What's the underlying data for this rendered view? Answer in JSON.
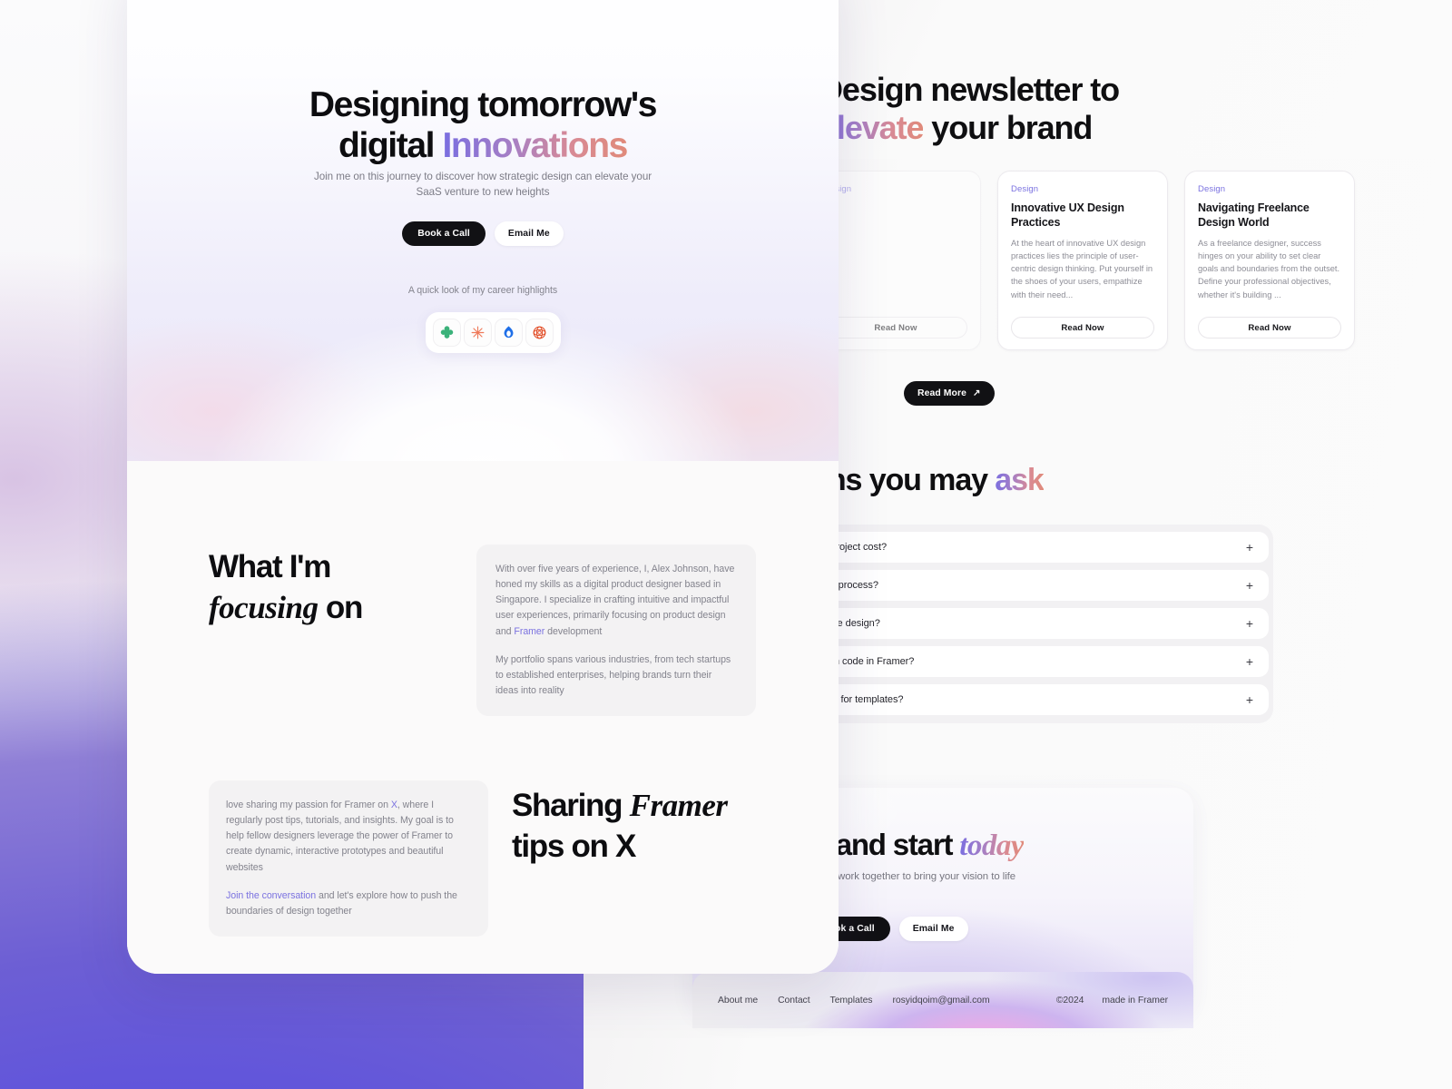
{
  "left_panel": {
    "hero": {
      "title_line1": "Designing tomorrow's",
      "title_line2_plain": "digital ",
      "title_line2_accent": "Innovations",
      "subtitle": "Join me on this journey to discover how strategic design can elevate your SaaS venture to new heights",
      "primary_button": "Book a Call",
      "secondary_button": "Email Me",
      "highlights_label": "A quick look of my career highlights",
      "logos": [
        {
          "name": "clover-logo-icon",
          "color": "#3bb27a"
        },
        {
          "name": "asterisk-logo-icon",
          "color": "#ef7a5a"
        },
        {
          "name": "droplet-logo-icon",
          "color": "#1f6fe8"
        },
        {
          "name": "flower-logo-icon",
          "color": "#e2502a"
        }
      ]
    },
    "focus_section": {
      "title_part1": "What I'm",
      "title_italic": "focusing",
      "title_part2": " on",
      "paragraph1_a": "With over five years of experience, I, Alex Johnson, have honed my skills as a digital product designer based in Singapore. I specialize in crafting intuitive and impactful user experiences, primarily focusing on product design and ",
      "paragraph1_link": "Framer",
      "paragraph1_b": " development",
      "paragraph2": "My portfolio spans various industries, from tech startups to established enterprises, helping brands turn their ideas into reality"
    },
    "sharing_section": {
      "title_part1": "Sharing ",
      "title_italic": "Framer",
      "title_part2": "tips on X",
      "paragraph1_a": "love sharing my passion for Framer on ",
      "paragraph1_link": "X",
      "paragraph1_b": ", where I regularly post tips, tutorials, and insights. My goal is to help fellow designers leverage the power of Framer to create dynamic, interactive prototypes and beautiful websites",
      "paragraph2_link": "Join the conversation",
      "paragraph2_rest": " and let's explore how to push the boundaries of design together"
    }
  },
  "right_panel": {
    "newsletter": {
      "title_line1": "Design newsletter to",
      "title_accent": "elevate",
      "title_line2_rest": " your brand"
    },
    "blog": {
      "ghost_card": {
        "category": "Design",
        "title": "",
        "excerpt": "",
        "button": "Read Now"
      },
      "cards": [
        {
          "category": "Design",
          "title": "Innovative UX Design Practices",
          "excerpt": "At the heart of innovative UX design practices lies the principle of user-centric design thinking. Put yourself in the shoes of your users, empathize with their need...",
          "button": "Read Now"
        },
        {
          "category": "Design",
          "title": "Navigating Freelance Design World",
          "excerpt": "As a freelance designer, success hinges on your ability to set clear goals and boundaries from the outset. Define your professional objectives, whether it's building ...",
          "button": "Read Now"
        }
      ],
      "read_more_label": "Read More",
      "read_more_icon": "arrow-up-right-icon"
    },
    "faq": {
      "title_plain": "Questions you may ",
      "title_accent": "ask",
      "items": [
        {
          "question": "How much does a project cost?",
          "toggle": "+"
        },
        {
          "question": "What is your design process?",
          "toggle": "+"
        },
        {
          "question": "What if I don't like the design?",
          "toggle": "+"
        },
        {
          "question": "Can you add custom code in Framer?",
          "toggle": "+"
        },
        {
          "question": "Do you offer refunds for templates?",
          "toggle": "+"
        }
      ]
    },
    "cta": {
      "title_plain": "Let's talk and start ",
      "title_accent": "today",
      "subtitle": "Got a project in mind? Let's work together to bring your vision to life",
      "primary_button": "Book a Call",
      "secondary_button": "Email Me"
    },
    "footer": {
      "links": [
        "About me",
        "Contact",
        "Templates"
      ],
      "email": "rosyidqoim@gmail.com",
      "copyright": "©2024",
      "made_in_prefix": "made in ",
      "made_in_brand": "Framer"
    }
  },
  "colors": {
    "accent_purple": "#7b72e0",
    "bg_purple": "#5b4fd1",
    "dark_button": "#111114",
    "muted_text": "#83838d"
  }
}
